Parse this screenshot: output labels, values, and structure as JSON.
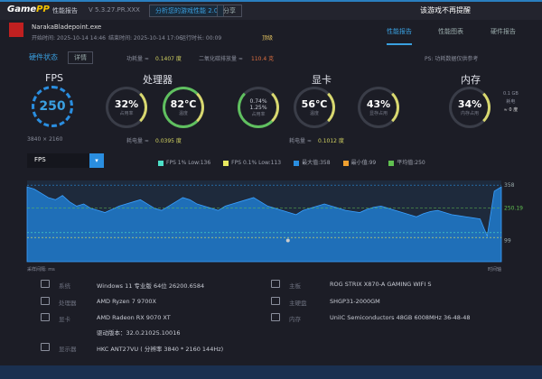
{
  "titlebar": {
    "app": "GamePP",
    "title": "性能报告",
    "version": "V 5.3.27.PR.XXX",
    "btn1": "分析您的游戏性能 2.0",
    "btn2": "分享",
    "notice": "该游戏不再提醒"
  },
  "game": {
    "name": "NarakaBladepoint.exe",
    "start": "开始时间: 2025-10-14 14:46",
    "end": "结束时间: 2025-10-14 17:06",
    "duration": "运行时长: 00:09",
    "tag": "顶级"
  },
  "tabs": [
    {
      "label": "性能报告",
      "active": true
    },
    {
      "label": "性能图表",
      "active": false
    },
    {
      "label": "硬件报告",
      "active": false
    }
  ],
  "status": {
    "label": "硬件状态",
    "btn": "详情",
    "power_label": "功耗量 ≈",
    "power_value": "0.1407 度",
    "carbon_label": "二氧化碳排放量 ≈",
    "carbon_value": "110.4 克",
    "right_note": "PS: 功耗数据仅供参考"
  },
  "fps": {
    "title": "FPS",
    "value": "250",
    "resolution": "3840 × 2160"
  },
  "cpu": {
    "title": "处理器",
    "usage": "32%",
    "usage_label": "占用率",
    "temp": "82℃",
    "temp_label": "温度",
    "power_label": "耗电量 ≈",
    "power_value": "0.0395 度"
  },
  "gpu": {
    "title": "显卡",
    "usage": "0.74%\n1.25%",
    "usage_label": "占用率",
    "temp": "56℃",
    "temp_label": "温度",
    "vram": "43%",
    "vram_label": "显存占用",
    "power_label": "耗电量 ≈",
    "power_value": "0.1012 度"
  },
  "memory": {
    "title": "内存",
    "usage": "34%",
    "usage_label": "内存占用",
    "side1": "0.1 GB",
    "side2": "耗电",
    "side3": "≈ 0 度"
  },
  "chart_controls": {
    "metric": "FPS",
    "legend": [
      {
        "label": "FPS 1% Low:136",
        "color": "#4de0c8"
      },
      {
        "label": "FPS 0.1% Low:113",
        "color": "#e8e860"
      },
      {
        "label": "最大值:358",
        "color": "#2a8ee0"
      },
      {
        "label": "最小值:99",
        "color": "#f0a030"
      },
      {
        "label": "平均值:250",
        "color": "#60c050"
      }
    ]
  },
  "chart_data": {
    "type": "area",
    "title": "",
    "xlabel": "",
    "ylabel": "",
    "ylim": [
      0,
      380
    ],
    "y_ticks": [
      "358",
      "250.19",
      "99"
    ],
    "x_start_label": "采样间隔: ms",
    "x_end_label": "时间轴",
    "series": [
      {
        "values": [
          350,
          340,
          320,
          300,
          290,
          310,
          280,
          260,
          270,
          250,
          240,
          230,
          245,
          260,
          270,
          280,
          290,
          270,
          250,
          240,
          260,
          280,
          300,
          290,
          270,
          260,
          250,
          240,
          260,
          270,
          280,
          290,
          300,
          280,
          260,
          250,
          240,
          230,
          220,
          240,
          250,
          260,
          270,
          260,
          250,
          240,
          235,
          230,
          245,
          255,
          260,
          250,
          240,
          230,
          220,
          210,
          225,
          235,
          240,
          230,
          220,
          215,
          210,
          205,
          200,
          120,
          330,
          350
        ]
      }
    ],
    "hlines": {
      "avg": 250.19,
      "low1": 136,
      "low01": 113,
      "min": 99,
      "max": 358
    }
  },
  "specs": [
    {
      "label": "系统",
      "value": "Windows 11 专业版 64位 26200.6584",
      "icon": "windows-icon"
    },
    {
      "label": "处理器",
      "value": "AMD Ryzen 7 9700X",
      "icon": "cpu-icon"
    },
    {
      "label": "显卡",
      "value": "AMD Radeon RX 9070 XT",
      "icon": "gpu-icon"
    },
    {
      "label": "",
      "value": "驱动版本：32.0.21025.10016",
      "icon": ""
    },
    {
      "label": "显示器",
      "value": "HKC ANT27VU ( 分辨率 3840 * 2160 144Hz)",
      "icon": "monitor-icon"
    },
    {
      "label": "主板",
      "value": "ROG STRIX X870-A GAMING WIFI S",
      "icon": "motherboard-icon"
    },
    {
      "label": "主硬盘",
      "value": "SHGP31-2000GM",
      "icon": "disk-icon"
    },
    {
      "label": "内存",
      "value": "UniIC Semiconductors 48GB 6008MHz 36-48-48",
      "icon": "memory-icon"
    }
  ]
}
